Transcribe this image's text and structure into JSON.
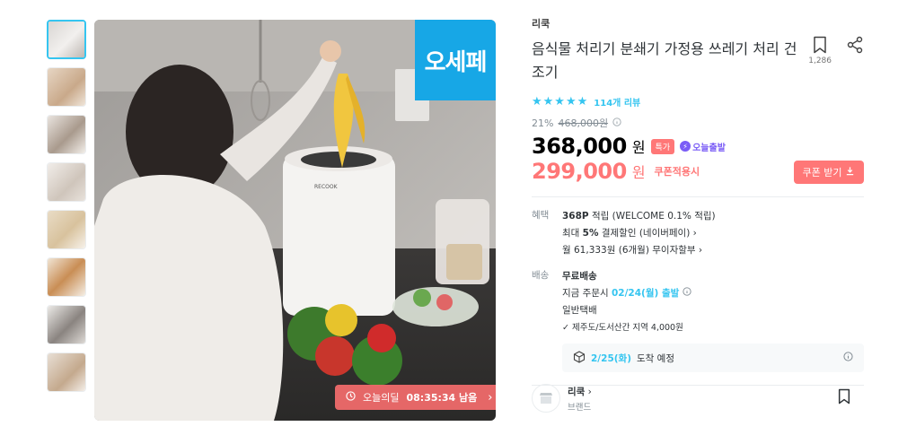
{
  "product": {
    "brand": "리쿡",
    "title": "음식물 처리기 분쇄기 가정용 쓰레기 처리 건조기",
    "bookmark_count": "1,286",
    "rating_stars": "★★★★★",
    "reviews": "114개 리뷰",
    "discount_rate": "21%",
    "original_price": "468,000원",
    "price": "368,000",
    "won": "원",
    "tag_special": "특가",
    "tag_today": "오늘출발",
    "coupon_price": "299,000",
    "coupon_label": "쿠폰적용시",
    "coupon_button": "쿠폰 받기"
  },
  "main_image": {
    "badge": "오세페",
    "deal_label": "오늘의딜",
    "deal_timer": "08:35:34 남음"
  },
  "benefit": {
    "label": "혜택",
    "points_bold": "368P",
    "points_rest": "적립 (WELCOME 0.1% 적립)",
    "card_pre": "최대",
    "card_bold": "5%",
    "card_rest": "결제할인 (네이버페이)",
    "installment": "월 61,333원 (6개월) 무이자할부"
  },
  "shipping": {
    "label": "배송",
    "free": "무료배송",
    "order_pre": "지금 주문시",
    "order_date": "02/24(월) 출발",
    "method": "일반택배",
    "extra": "제주도/도서산간 지역 4,000원",
    "arrive_date": "2/25(화)",
    "arrive_rest": "도착 예정"
  },
  "store": {
    "name": "리쿡",
    "sub": "브랜드"
  },
  "colors": {
    "accent": "#35c5f0",
    "sale": "#ff7777",
    "badge": "#17a7e6"
  }
}
